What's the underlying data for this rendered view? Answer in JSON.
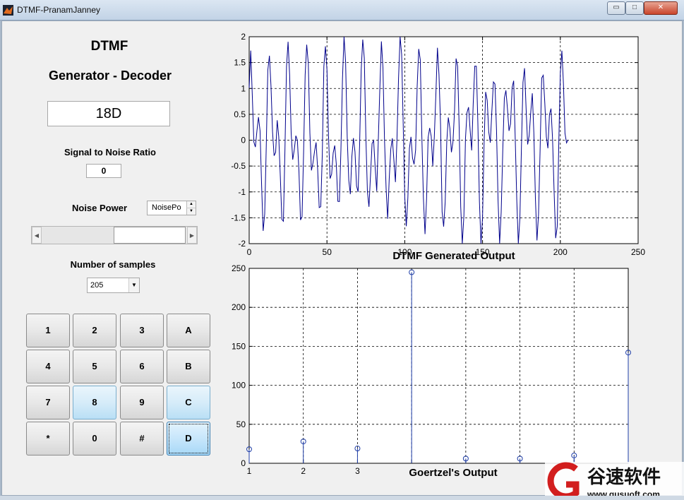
{
  "window": {
    "title": "DTMF-PranamJanney",
    "controls": {
      "minimize": "▭",
      "maximize": "□",
      "close": "✕"
    }
  },
  "header": {
    "title": "DTMF",
    "subtitle": "Generator - Decoder"
  },
  "display": {
    "value": "18D"
  },
  "snr": {
    "label": "Signal to Noise Ratio",
    "value": "0"
  },
  "noise": {
    "label": "Noise Power",
    "spinner_value": "NoisePo"
  },
  "slider": {
    "level": 0.5
  },
  "samples": {
    "label": "Number of samples",
    "selected": "205"
  },
  "keypad": [
    [
      "1",
      "2",
      "3",
      "A"
    ],
    [
      "4",
      "5",
      "6",
      "B"
    ],
    [
      "7",
      "8",
      "9",
      "C"
    ],
    [
      "*",
      "0",
      "#",
      "D"
    ]
  ],
  "chart_data": [
    {
      "type": "line",
      "title": "DTMF Generated Output",
      "xlim": [
        0,
        250
      ],
      "ylim": [
        -2,
        2
      ],
      "xticks": [
        "0",
        "50",
        "100",
        "150",
        "200",
        "250"
      ],
      "yticks": [
        "-2",
        "-1.5",
        "-1",
        "-0.5",
        "0",
        "0.5",
        "1",
        "1.5",
        "2"
      ],
      "grid": true,
      "series": [
        {
          "color": "#00008b",
          "description_of_content": "sum of two sinusoids plus noise, sampled n = 0..205",
          "freqs_normalized": [
            0.085,
            0.165
          ],
          "amplitude": 1
        }
      ]
    },
    {
      "type": "stem",
      "title": "Goertzel's Output",
      "xlim": [
        1,
        8
      ],
      "ylim": [
        0,
        250
      ],
      "xticks": [
        "1",
        "2",
        "3"
      ],
      "yticks": [
        "0",
        "50",
        "100",
        "150",
        "200",
        "250"
      ],
      "grid": true,
      "x": [
        1,
        2,
        3,
        4,
        5,
        6,
        7,
        8
      ],
      "values": [
        18,
        28,
        19,
        245,
        6,
        6,
        10,
        142
      ],
      "color": "#1f3ea8"
    }
  ],
  "watermark": {
    "text": "谷速软件",
    "url": "www.gusuoft.com"
  }
}
